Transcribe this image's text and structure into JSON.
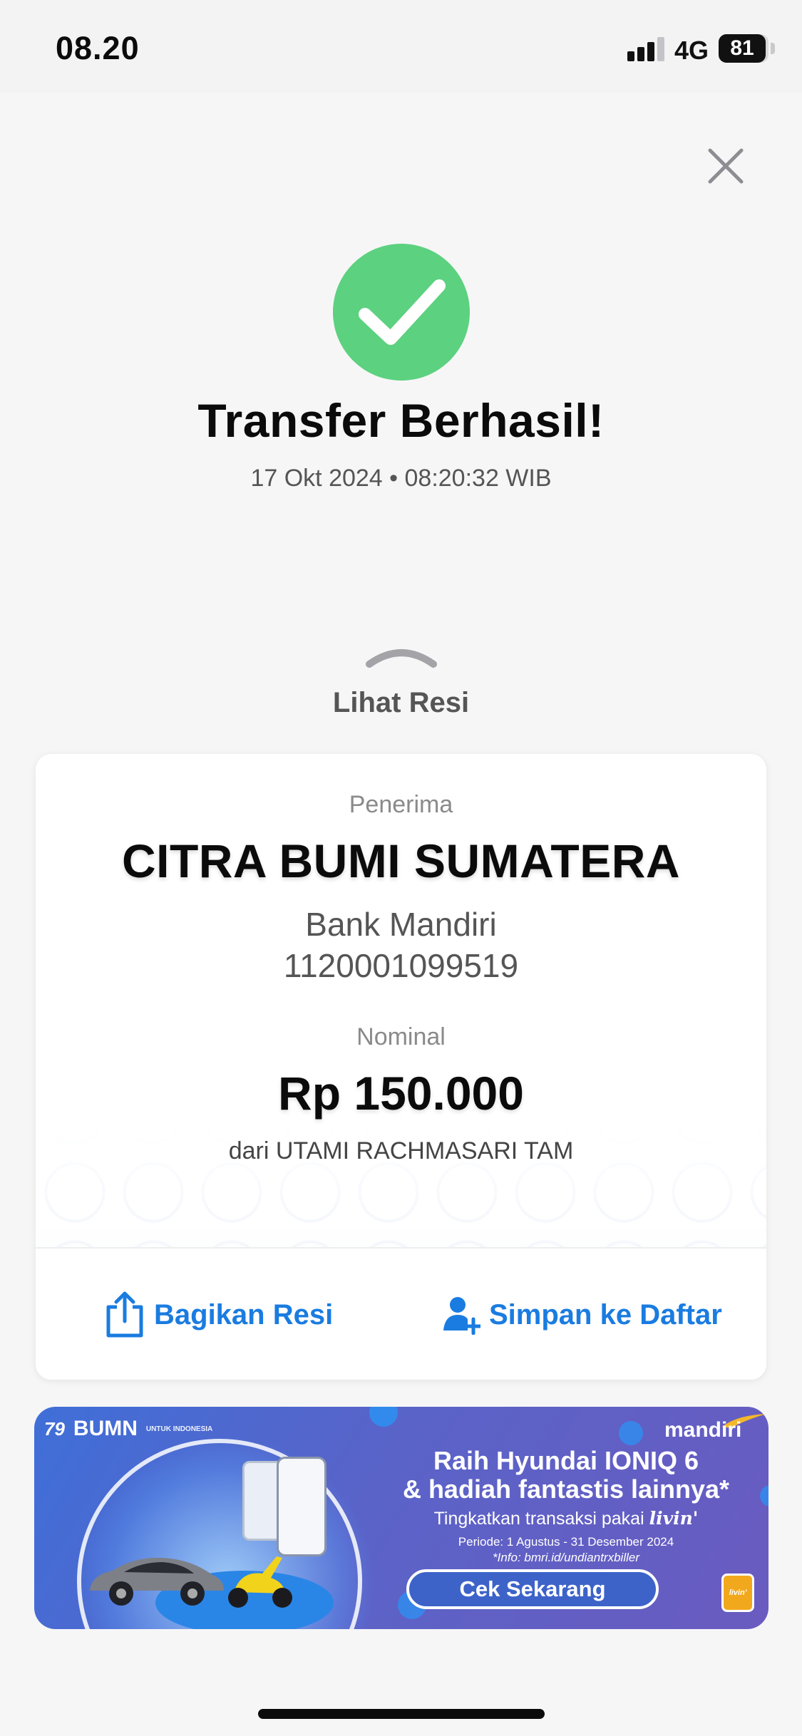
{
  "status_bar": {
    "time": "08.20",
    "network": "4G",
    "battery": "81"
  },
  "header": {
    "title": "Transfer Berhasil!",
    "timestamp": "17 Okt 2024 • 08:20:32 WIB"
  },
  "receipt_toggle": {
    "label": "Lihat Resi"
  },
  "receipt": {
    "recipient_label": "Penerima",
    "recipient_name": "CITRA BUMI SUMATERA",
    "bank": "Bank Mandiri",
    "account_number": "1120001099519",
    "amount_label": "Nominal",
    "amount": "Rp 150.000",
    "from": "dari UTAMI RACHMASARI TAM"
  },
  "actions": {
    "share_label": "Bagikan Resi",
    "save_label": "Simpan ke Daftar"
  },
  "promo": {
    "headline_1": "Raih Hyundai IONIQ 6",
    "headline_2": "& hadiah fantastis lainnya*",
    "subtitle_prefix": "Tingkatkan transaksi pakai",
    "brand_app": "livin'",
    "period": "Periode: 1 Agustus - 31 Desember 2024",
    "info": "*Info: bmri.id/undiantrxbiller",
    "cta": "Cek Sekarang",
    "brand": "mandiri",
    "partner": "BUMN",
    "partner_tag": "UNTUK INDONESIA",
    "anniversary": "79"
  },
  "colors": {
    "success_green": "#5cd17f",
    "link_blue": "#1a7ce0",
    "background": "#f6f6f7"
  },
  "icons": {
    "close": "close-icon",
    "success": "check-icon",
    "share": "share-icon",
    "add_contact": "add-person-icon",
    "chevron": "chevron-up-icon"
  }
}
